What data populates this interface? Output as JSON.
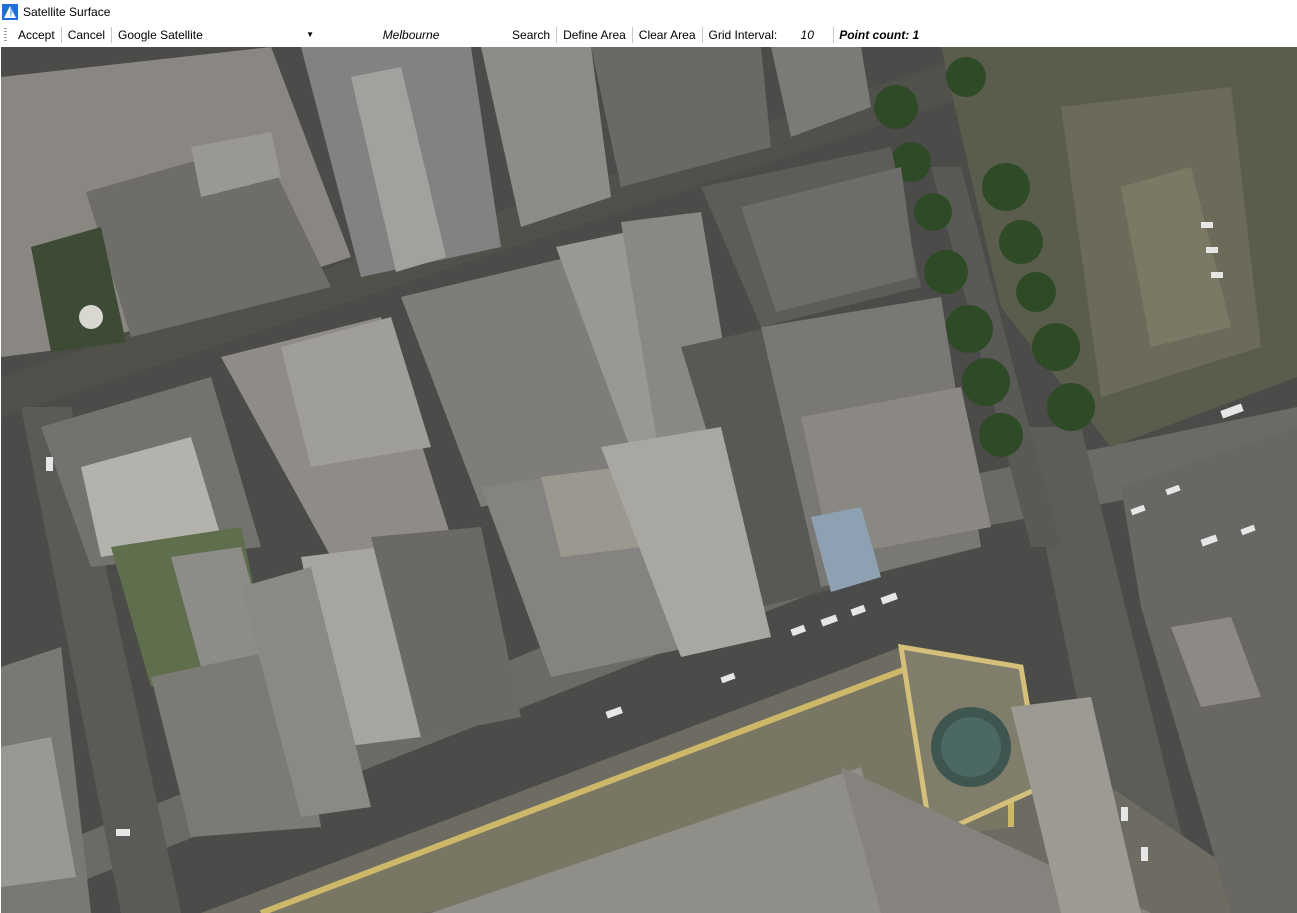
{
  "window": {
    "title": "Satellite Surface"
  },
  "toolbar": {
    "accept_label": "Accept",
    "cancel_label": "Cancel",
    "map_source": {
      "selected": "Google Satellite"
    },
    "location_value": "Melbourne",
    "search_label": "Search",
    "define_area_label": "Define Area",
    "clear_area_label": "Clear Area",
    "grid_interval_label": "Grid Interval:",
    "grid_interval_value": "10",
    "point_count_text": "Point count: 1"
  },
  "icons": {
    "app": "app-logo-icon",
    "dropdown": "chevron-down-icon"
  },
  "colors": {
    "app_icon": "#1e6fd9",
    "map_asphalt": "#4a4a48",
    "station_trim": "#cdb86a"
  }
}
